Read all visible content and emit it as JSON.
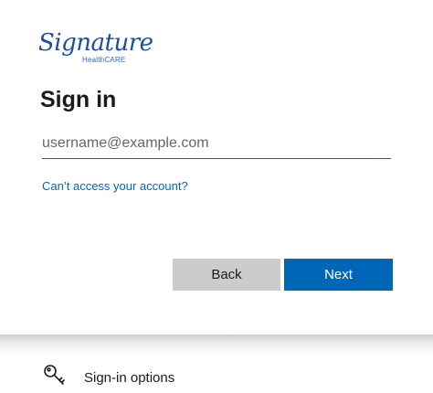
{
  "brand": {
    "script": "Signature",
    "subtitle": "HealthCARE",
    "color": "#1e4e9a"
  },
  "signin": {
    "title": "Sign in",
    "username_placeholder": "username@example.com",
    "username_value": "",
    "cant_access_link": "Can’t access your account?"
  },
  "buttons": {
    "back": "Back",
    "next": "Next",
    "primary_color": "#0067b8"
  },
  "footer": {
    "options_label": "Sign-in options",
    "icon": "key-icon"
  }
}
